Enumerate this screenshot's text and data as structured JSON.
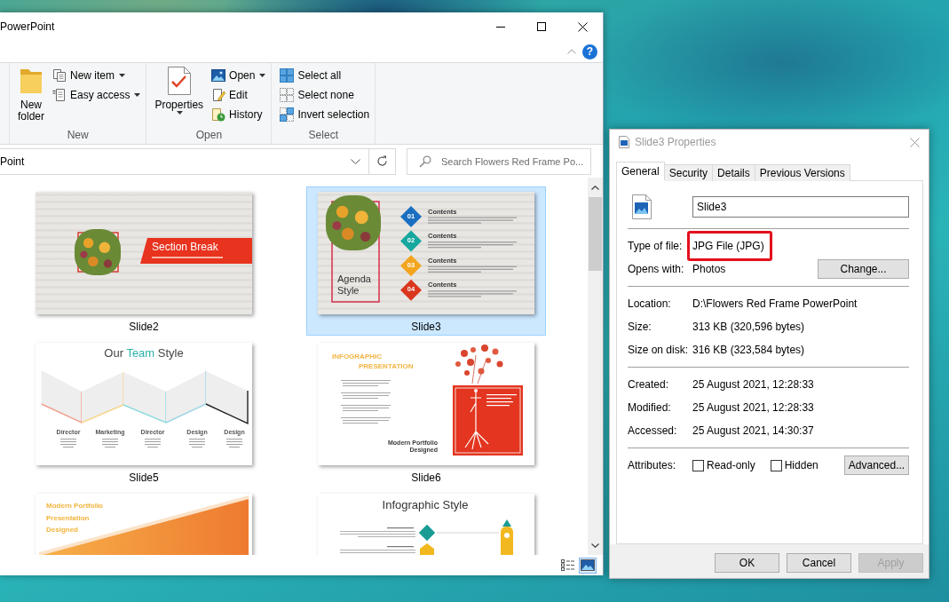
{
  "explorer": {
    "title": "PowerPoint",
    "help": "?",
    "ribbon": [
      {
        "label": "New",
        "large": {
          "label": "New folder",
          "kind": "folder",
          "dropdown": false
        },
        "items": [
          {
            "label": "New item",
            "kind": "new-item",
            "dropdown": true
          },
          {
            "label": "Easy access",
            "kind": "easy-access",
            "dropdown": true
          }
        ]
      },
      {
        "label": "Open",
        "large": {
          "label": "Properties",
          "kind": "properties",
          "dropdown": true
        },
        "items": [
          {
            "label": "Open",
            "kind": "open",
            "dropdown": true
          },
          {
            "label": "Edit",
            "kind": "edit",
            "dropdown": false
          },
          {
            "label": "History",
            "kind": "history",
            "dropdown": false
          }
        ]
      },
      {
        "label": "Select",
        "items": [
          {
            "label": "Select all",
            "kind": "select-all",
            "dropdown": false
          },
          {
            "label": "Select none",
            "kind": "select-none",
            "dropdown": false
          },
          {
            "label": "Invert selection",
            "kind": "invert-selection",
            "dropdown": false
          }
        ]
      }
    ],
    "address": "Point",
    "search": {
      "placeholder": "Search Flowers Red Frame Po..."
    },
    "files": [
      {
        "name": "Slide2",
        "selected": false,
        "slide": {
          "kind": "section-break",
          "title": "Section Break"
        }
      },
      {
        "name": "Slide3",
        "selected": true,
        "slide": {
          "kind": "agenda",
          "title": "Agenda Style",
          "items": [
            {
              "number": "01",
              "heading": "Contents",
              "color": "#1b6fc0"
            },
            {
              "number": "02",
              "heading": "Contents",
              "color": "#17a79e"
            },
            {
              "number": "03",
              "heading": "Contents",
              "color": "#f2a51f"
            },
            {
              "number": "04",
              "heading": "Contents",
              "color": "#d9381e"
            }
          ]
        }
      },
      {
        "name": "Slide5",
        "selected": false,
        "slide": {
          "kind": "team",
          "title": [
            {
              "text": "Our ",
              "accent": false
            },
            {
              "text": "Team",
              "accent": true
            },
            {
              "text": " Style",
              "accent": false
            }
          ],
          "members": [
            {
              "role": "Director",
              "color": "#f2a08e"
            },
            {
              "role": "Marketing",
              "color": "#f6d58c"
            },
            {
              "role": "Director",
              "color": "#8edbdc"
            },
            {
              "role": "Design",
              "color": "#9fd6e6"
            },
            {
              "role": "Design",
              "color": "#222222"
            }
          ]
        }
      },
      {
        "name": "Slide6",
        "selected": false,
        "slide": {
          "kind": "infographic",
          "title": [
            "INFOGRAPHIC",
            "PRESENTATION"
          ],
          "caption": [
            "Modern Portfolio",
            "Designed"
          ]
        }
      },
      {
        "selected": false,
        "slide": {
          "kind": "portfolio",
          "title": [
            "Modern Portfolio",
            "Presentation",
            "Designed"
          ]
        }
      },
      {
        "selected": false,
        "slide": {
          "kind": "infographic-style",
          "title": "Infographic Style"
        }
      }
    ],
    "views": [
      {
        "kind": "details",
        "selected": false
      },
      {
        "kind": "large-icons",
        "selected": true
      }
    ]
  },
  "dialog": {
    "title": "Slide3 Properties",
    "tabs": [
      {
        "label": "General",
        "selected": true
      },
      {
        "label": "Security",
        "selected": false
      },
      {
        "label": "Details",
        "selected": false
      },
      {
        "label": "Previous Versions",
        "selected": false
      }
    ],
    "file_name": "Slide3",
    "sections": [
      {
        "rows": [
          {
            "label": "Type of file:",
            "value": "JPG File (JPG)",
            "highlighted": true
          },
          {
            "label": "Opens with:",
            "value": "Photos",
            "highlighted": false,
            "button": "Change..."
          }
        ]
      },
      {
        "rows": [
          {
            "label": "Location:",
            "value": "D:\\Flowers Red Frame PowerPoint",
            "highlighted": false
          },
          {
            "label": "Size:",
            "value": "313 KB (320,596 bytes)",
            "highlighted": false
          },
          {
            "label": "Size on disk:",
            "value": "316 KB (323,584 bytes)",
            "highlighted": false
          }
        ]
      },
      {
        "rows": [
          {
            "label": "Created:",
            "value": "25 August 2021, 12:28:33",
            "highlighted": false
          },
          {
            "label": "Modified:",
            "value": "25 August 2021, 12:28:33",
            "highlighted": false
          },
          {
            "label": "Accessed:",
            "value": "25 August 2021, 14:30:37",
            "highlighted": false
          }
        ]
      }
    ],
    "attributes": {
      "label": "Attributes:",
      "options": [
        {
          "label": "Read-only",
          "checked": false
        },
        {
          "label": "Hidden",
          "checked": false
        }
      ],
      "button": "Advanced..."
    },
    "buttons": [
      {
        "label": "OK",
        "disabled": false
      },
      {
        "label": "Cancel",
        "disabled": false
      },
      {
        "label": "Apply",
        "disabled": true
      }
    ]
  }
}
